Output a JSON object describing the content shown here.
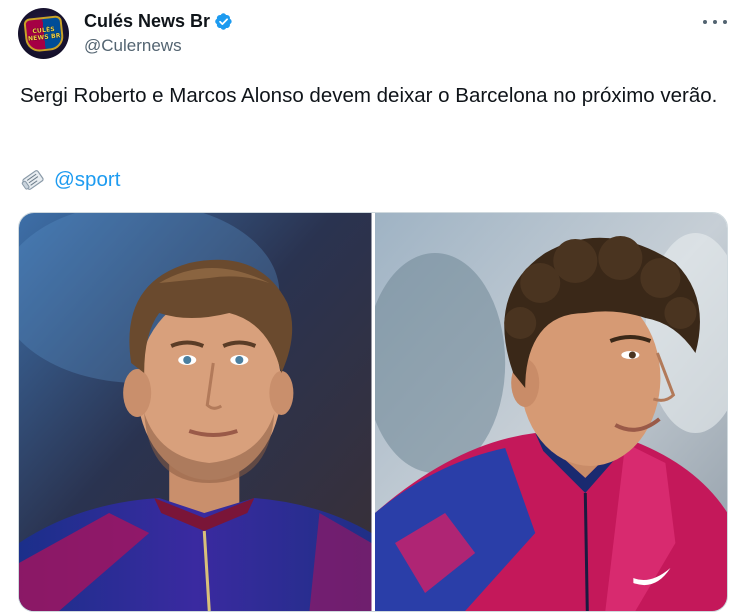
{
  "author": {
    "display_name": "Culés News Br",
    "handle": "@Culernews",
    "avatar_text": [
      "CULÉS",
      "NEWS BR"
    ],
    "verified": true
  },
  "tweet": {
    "text": "Sergi Roberto e Marcos Alonso devem deixar o Barcelona no próximo verão.",
    "source_icon": "newspaper-icon",
    "source_mention": "@sport"
  },
  "media": {
    "photos": [
      {
        "subject": "sergi-roberto-photo"
      },
      {
        "subject": "marcos-alonso-photo"
      }
    ]
  },
  "colors": {
    "accent": "#1d9bf0",
    "text_primary": "#0f1419",
    "text_secondary": "#536471",
    "border": "#cfd9de",
    "barca_blue": "#004d98",
    "barca_red": "#a50044"
  }
}
